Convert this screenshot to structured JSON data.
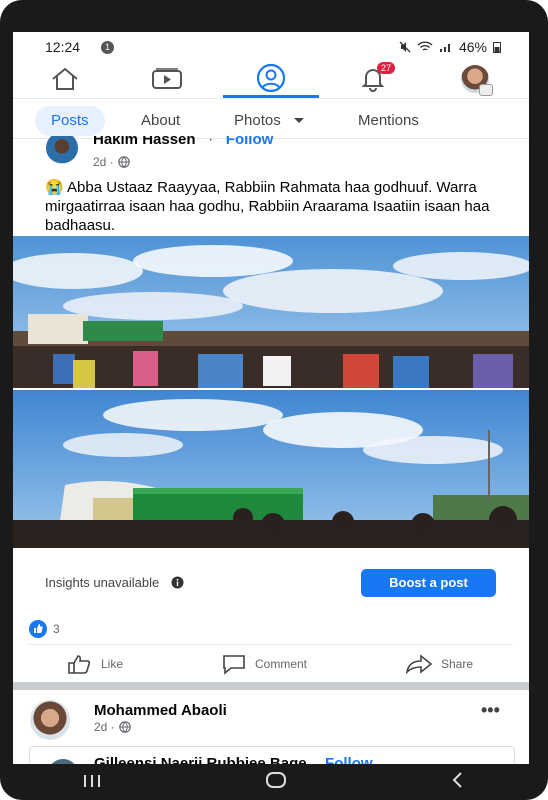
{
  "status": {
    "time": "12:24",
    "notif_count": "1",
    "battery": "46%"
  },
  "nav": {
    "notifications_badge": "27"
  },
  "tabs": [
    {
      "label": "Posts"
    },
    {
      "label": "About"
    },
    {
      "label": "Photos"
    },
    {
      "label": "Mentions"
    }
  ],
  "post1": {
    "author": "Hakim Hassen",
    "separator": "·",
    "follow": "Follow",
    "time": "2d ·",
    "emoji": "😭",
    "text": "Abba Ustaaz Raayyaa, Rabbiin Rahmata haa godhuuf. Warra mirgaatirraa isaan haa godhu, Rabbiin Araarama Isaatiin isaan haa badhaasu.",
    "insights": "Insights unavailable",
    "boost": "Boost a post",
    "reaction_count": "3",
    "like": "Like",
    "comment": "Comment",
    "share": "Share"
  },
  "post2": {
    "author": "Mohammed Abaoli",
    "time": "2d ·",
    "shared_author": "Gilleensi Naerii Rubbiee Bage",
    "follow": "Follow"
  },
  "colors": {
    "accent": "#1877f2",
    "badge": "#e41e3f"
  }
}
